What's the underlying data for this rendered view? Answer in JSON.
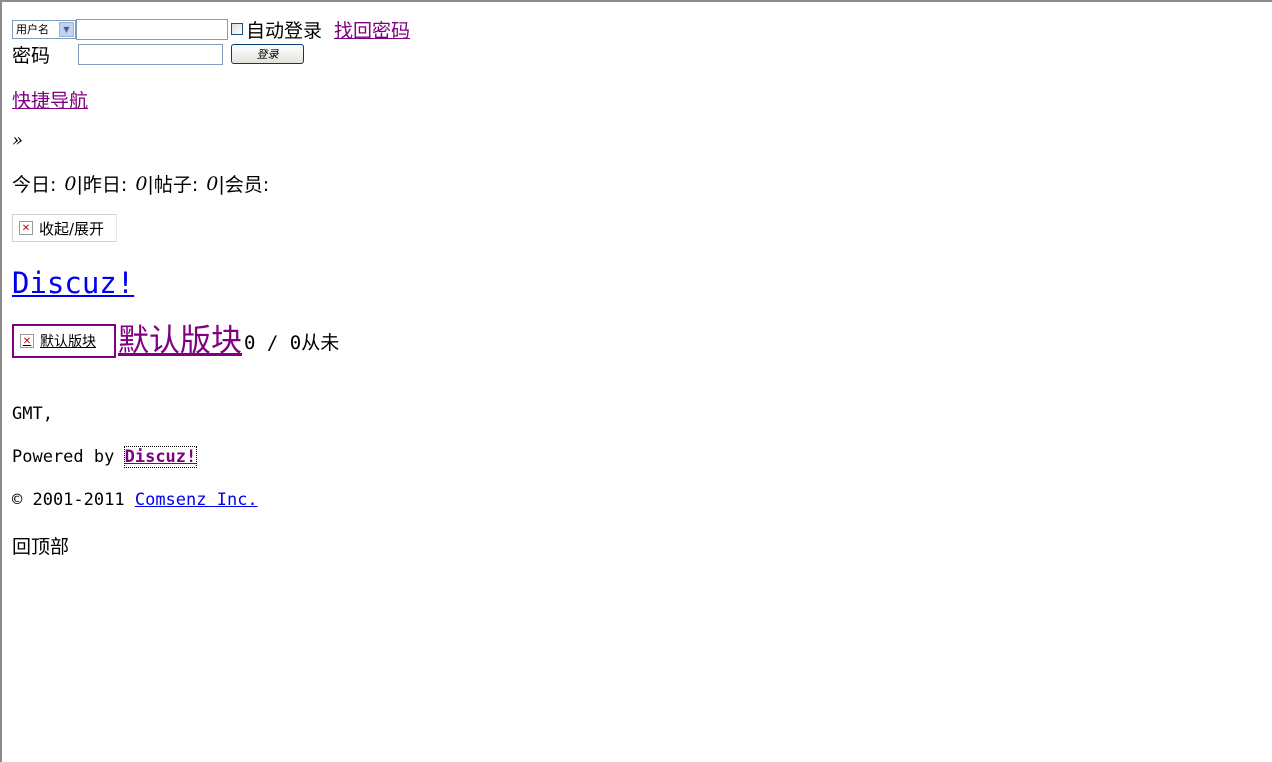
{
  "login": {
    "account_type_selected": "用户名",
    "username_value": "",
    "auto_login_label": "自动登录",
    "find_password_link": "找回密码",
    "password_label": "密码",
    "password_value": "",
    "login_button": "登录"
  },
  "nav": {
    "quick_nav_link": "快捷导航",
    "breadcrumb_sep": "»"
  },
  "stats": {
    "today_label": "今日:",
    "today_value": "0",
    "yesterday_label": "昨日:",
    "yesterday_value": "0",
    "posts_label": "帖子:",
    "posts_value": "0",
    "members_label": "会员:",
    "separator": "|"
  },
  "toggle": {
    "label": "收起/展开"
  },
  "category": {
    "title": "Discuz!"
  },
  "forum": {
    "image_alt": "默认版块",
    "name": "默认版块",
    "meta": "0 / 0从未"
  },
  "footer": {
    "gmt": "GMT,",
    "powered_prefix": "Powered by",
    "powered_link": "Discuz!",
    "copyright_prefix": "© 2001-2011",
    "company_link": "Comsenz Inc.",
    "back_to_top": "回顶部"
  }
}
